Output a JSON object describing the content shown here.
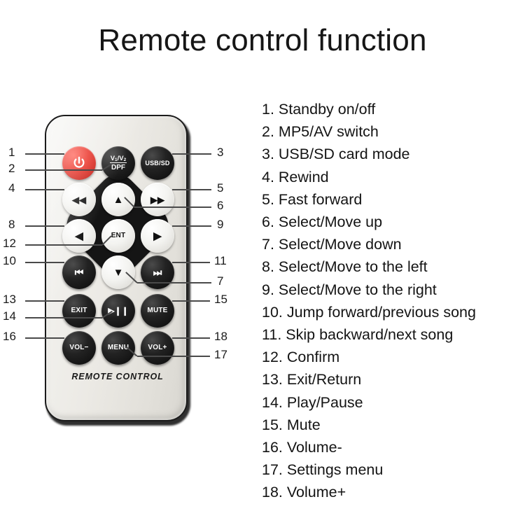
{
  "page": {
    "title": "Remote control function",
    "background_color": "#ffffff",
    "text_color": "#141414"
  },
  "remote": {
    "brand_text": "REMOTE CONTROL",
    "body_color": "#ecebe6",
    "outline_color": "#1b1b1b",
    "power_button_color": "#e8271c",
    "buttons": [
      {
        "id": "power",
        "label": "",
        "icon": "power-icon",
        "style": "red",
        "col": 0,
        "row": 0
      },
      {
        "id": "dpf",
        "label": "V1/V2 DPF",
        "icon": "dpf-text",
        "style": "black",
        "col": 1,
        "row": 0,
        "line1": "V",
        "sub1": "1",
        "mid": "/V",
        "sub2": "2",
        "line2": "DPF"
      },
      {
        "id": "usbsd",
        "label": "USB/SD",
        "icon": "usb-sd-text",
        "style": "black",
        "col": 2,
        "row": 0
      },
      {
        "id": "rewind",
        "label": "",
        "icon": "rewind-icon",
        "style": "white",
        "col": 0,
        "row": 1,
        "glyph": "◀◀"
      },
      {
        "id": "up",
        "label": "",
        "icon": "arrow-up-icon",
        "style": "white",
        "col": 1,
        "row": 1,
        "glyph": "▲"
      },
      {
        "id": "fastforward",
        "label": "",
        "icon": "fast-forward-icon",
        "style": "white",
        "col": 2,
        "row": 1,
        "glyph": "▶▶"
      },
      {
        "id": "left",
        "label": "",
        "icon": "arrow-left-icon",
        "style": "white",
        "col": 0,
        "row": 2,
        "glyph": "◀"
      },
      {
        "id": "ent",
        "label": "ENT",
        "icon": "enter-text",
        "style": "white",
        "col": 1,
        "row": 2
      },
      {
        "id": "right",
        "label": "",
        "icon": "arrow-right-icon",
        "style": "white",
        "col": 2,
        "row": 2,
        "glyph": "▶"
      },
      {
        "id": "prev",
        "label": "",
        "icon": "skip-previous-icon",
        "style": "black",
        "col": 0,
        "row": 3,
        "glyph": "⏮"
      },
      {
        "id": "down",
        "label": "",
        "icon": "arrow-down-icon",
        "style": "white",
        "col": 1,
        "row": 3,
        "glyph": "▼"
      },
      {
        "id": "next",
        "label": "",
        "icon": "skip-next-icon",
        "style": "black",
        "col": 2,
        "row": 3,
        "glyph": "⏭"
      },
      {
        "id": "exit",
        "label": "EXIT",
        "icon": "exit-text",
        "style": "black",
        "col": 0,
        "row": 4
      },
      {
        "id": "playpause",
        "label": "",
        "icon": "play-pause-icon",
        "style": "black",
        "col": 1,
        "row": 4,
        "glyph": "▶❙❙"
      },
      {
        "id": "mute",
        "label": "MUTE",
        "icon": "mute-text",
        "style": "black",
        "col": 2,
        "row": 4
      },
      {
        "id": "volumedown",
        "label": "VOL−",
        "icon": "volume-down-text",
        "style": "black",
        "col": 0,
        "row": 5
      },
      {
        "id": "menu",
        "label": "MENU",
        "icon": "menu-text",
        "style": "black",
        "col": 1,
        "row": 5
      },
      {
        "id": "volumeup",
        "label": "VOL+",
        "icon": "volume-up-text",
        "style": "black",
        "col": 2,
        "row": 5
      }
    ]
  },
  "callouts": {
    "left": [
      "1",
      "2",
      "4",
      "8",
      "12",
      "10",
      "13",
      "14",
      "16"
    ],
    "right": [
      "3",
      "5",
      "6",
      "9",
      "11",
      "7",
      "15",
      "18",
      "17"
    ]
  },
  "functions": [
    {
      "num": "1.",
      "text": "Standby on/off"
    },
    {
      "num": "2.",
      "text": "MP5/AV switch"
    },
    {
      "num": "3.",
      "text": "USB/SD card mode"
    },
    {
      "num": "4.",
      "text": "Rewind"
    },
    {
      "num": "5.",
      "text": "Fast forward"
    },
    {
      "num": "6.",
      "text": "Select/Move up"
    },
    {
      "num": "7.",
      "text": "Select/Move down"
    },
    {
      "num": "8.",
      "text": "Select/Move to the left"
    },
    {
      "num": "9.",
      "text": "Select/Move to the right"
    },
    {
      "num": "10.",
      "text": "Jump forward/previous song"
    },
    {
      "num": "11.",
      "text": "Skip backward/next song"
    },
    {
      "num": "12.",
      "text": "Confirm"
    },
    {
      "num": "13.",
      "text": "Exit/Return"
    },
    {
      "num": "14.",
      "text": "Play/Pause"
    },
    {
      "num": "15.",
      "text": "Mute"
    },
    {
      "num": "16.",
      "text": "Volume-"
    },
    {
      "num": "17.",
      "text": "Settings menu"
    },
    {
      "num": "18.",
      "text": "Volume+"
    }
  ]
}
